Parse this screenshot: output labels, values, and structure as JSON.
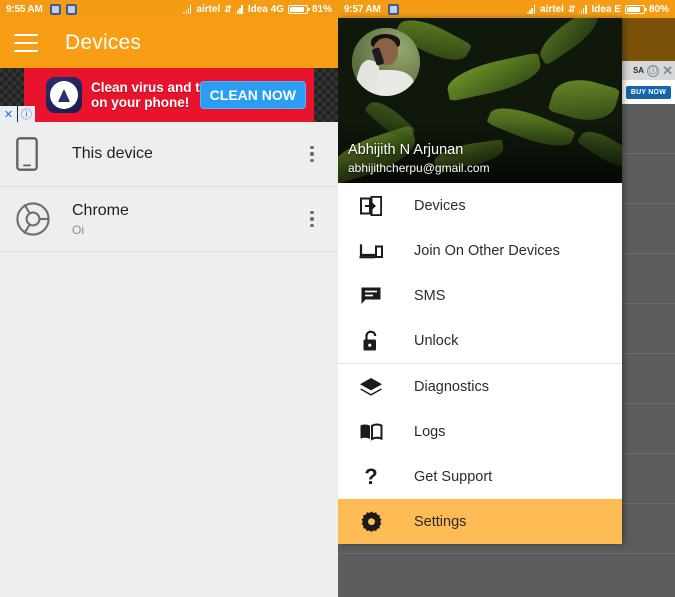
{
  "left_panel": {
    "status_bar": {
      "time": "9:55 AM",
      "carrier": "airtel",
      "network_label": "Idea 4G",
      "battery": "81%",
      "notification_icons": [
        "app-notification-icon",
        "app-notification-icon"
      ],
      "signal_icons": [
        "signal-bars-icon",
        "data-arrows-icon",
        "signal-bars-icon"
      ]
    },
    "app_bar": {
      "menu_icon": "hamburger-menu-icon",
      "title": "Devices"
    },
    "ad": {
      "headline_line1": "Clean virus and trash",
      "headline_line2": "on your phone!",
      "cta": "CLEAN NOW",
      "close_label": "✕",
      "info_label": "ⓘ",
      "logo_icon": "shield-arrow-icon",
      "background_color": "#E8142D",
      "cta_color": "#2A9DF4"
    },
    "devices": [
      {
        "title": "This device",
        "subtitle": "",
        "icon": "smartphone-icon",
        "overflow": "more-options-icon"
      },
      {
        "title": "Chrome",
        "subtitle": "Oi",
        "icon": "chrome-browser-icon",
        "overflow": "more-options-icon"
      }
    ]
  },
  "right_panel": {
    "status_bar": {
      "time": "9:57 AM",
      "carrier": "airtel",
      "network_label": "Idea E",
      "battery": "80%",
      "notification_icons": [
        "app-notification-icon"
      ],
      "signal_icons": [
        "signal-bars-icon",
        "data-arrows-icon",
        "signal-bars-icon"
      ]
    },
    "background_ad": {
      "brand": "SA",
      "cta": "BUY NOW",
      "info_label": "ⓘ",
      "close_label": "✕"
    },
    "drawer": {
      "account": {
        "name": "Abhijith N Arjunan",
        "email": "abhijithcherpu@gmail.com",
        "avatar": "user-avatar-photo"
      },
      "groups": [
        {
          "items": [
            {
              "label": "Devices",
              "icon": "devices-transfer-icon",
              "active": false
            },
            {
              "label": "Join On Other Devices",
              "icon": "laptop-phone-icon",
              "active": false
            },
            {
              "label": "SMS",
              "icon": "message-bubble-icon",
              "active": false
            },
            {
              "label": "Unlock",
              "icon": "unlock-padlock-icon",
              "active": false
            }
          ]
        },
        {
          "items": [
            {
              "label": "Diagnostics",
              "icon": "layers-icon",
              "active": false
            },
            {
              "label": "Logs",
              "icon": "open-book-icon",
              "active": false
            },
            {
              "label": "Get Support",
              "icon": "question-mark-icon",
              "active": false
            },
            {
              "label": "Settings",
              "icon": "gear-icon",
              "active": true
            }
          ]
        }
      ],
      "highlight_color": "#FFBC55"
    }
  },
  "theme": {
    "primary": "#F89E15",
    "status_bar": "#F49C14",
    "list_background": "#EEEEEE",
    "scrim": "#5C5C5C"
  }
}
